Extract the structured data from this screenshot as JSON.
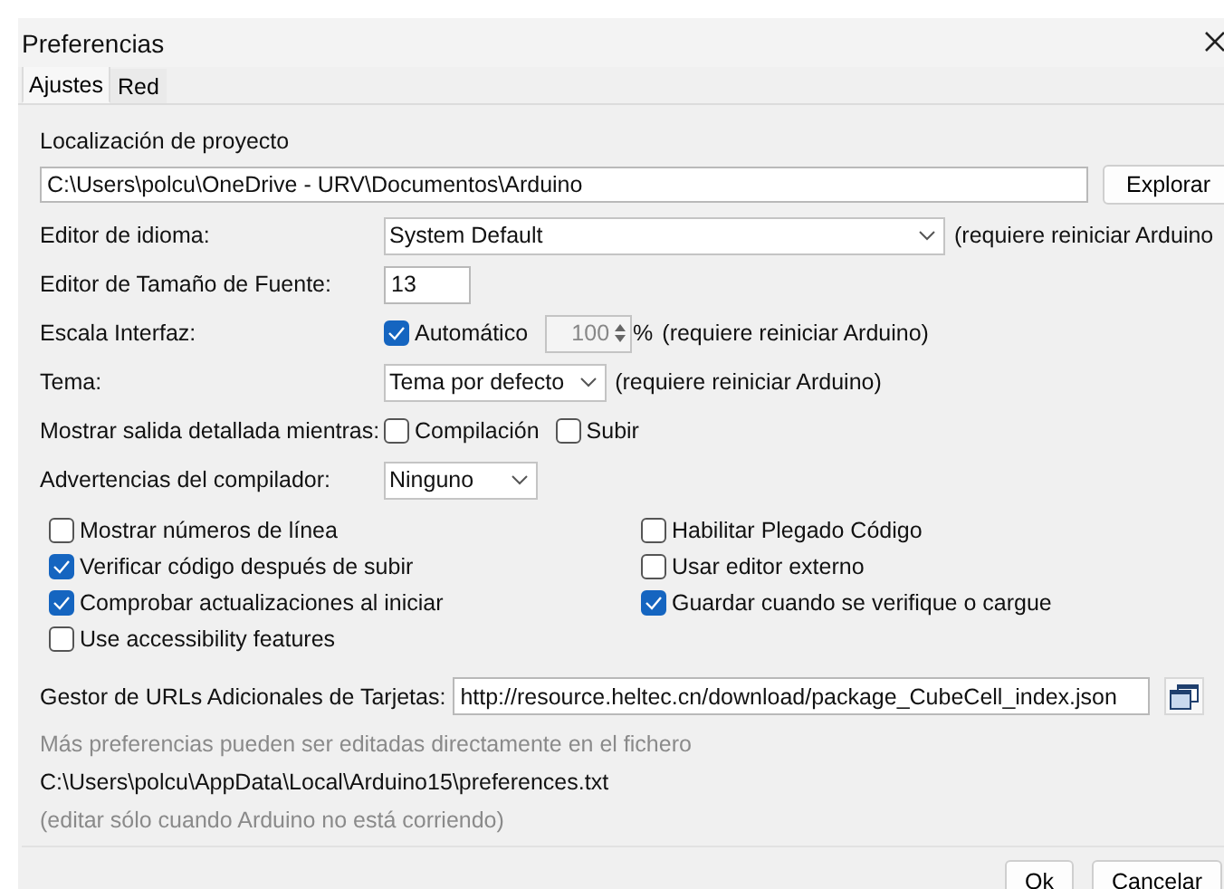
{
  "window": {
    "title": "Preferencias"
  },
  "tabs": [
    {
      "label": "Ajustes",
      "selected": true
    },
    {
      "label": "Red",
      "selected": false
    }
  ],
  "sketchbook": {
    "label": "Localización de proyecto",
    "value": "C:\\Users\\polcu\\OneDrive - URV\\Documentos\\Arduino",
    "button": "Explorar"
  },
  "settings": [
    {
      "kind": "select",
      "label": "Editor de idioma:",
      "value": "System Default",
      "note": "(requiere reiniciar Arduino"
    },
    {
      "kind": "text",
      "label": "Editor de Tamaño de Fuente:",
      "value": "13"
    },
    {
      "kind": "scale",
      "label": "Escala Interfaz:",
      "checkbox": {
        "label": "Automático",
        "checked": true
      },
      "value": "100",
      "unit": "%",
      "note": "(requiere reiniciar Arduino)"
    },
    {
      "kind": "select",
      "label": "Tema:",
      "value": "Tema por defecto",
      "note": "(requiere reiniciar Arduino)"
    },
    {
      "kind": "checks",
      "label": "Mostrar salida detallada mientras:",
      "options": [
        {
          "label": "Compilación",
          "checked": false
        },
        {
          "label": "Subir",
          "checked": false
        }
      ]
    },
    {
      "kind": "select",
      "label": "Advertencias del compilador:",
      "value": "Ninguno"
    }
  ],
  "options": [
    {
      "label": "Mostrar números de línea",
      "checked": false
    },
    {
      "label": "Habilitar Plegado Código",
      "checked": false
    },
    {
      "label": "Verificar código después de subir",
      "checked": true
    },
    {
      "label": "Usar editor externo",
      "checked": false
    },
    {
      "label": "Comprobar actualizaciones al iniciar",
      "checked": true
    },
    {
      "label": "Guardar cuando se verifique o cargue",
      "checked": true
    },
    {
      "label": "Use accessibility features",
      "checked": false
    }
  ],
  "urls": {
    "label": "Gestor de URLs Adicionales de Tarjetas:",
    "value": "http://resource.heltec.cn/download/package_CubeCell_index.json"
  },
  "notes": [
    {
      "kind": "muted",
      "text": "Más preferencias pueden ser editadas directamente en el fichero"
    },
    {
      "kind": "path",
      "text": "C:\\Users\\polcu\\AppData\\Local\\Arduino15\\preferences.txt"
    },
    {
      "kind": "muted",
      "text": "(editar sólo cuando Arduino no está corriendo)"
    }
  ],
  "buttons": [
    "Ok",
    "Cancelar"
  ]
}
